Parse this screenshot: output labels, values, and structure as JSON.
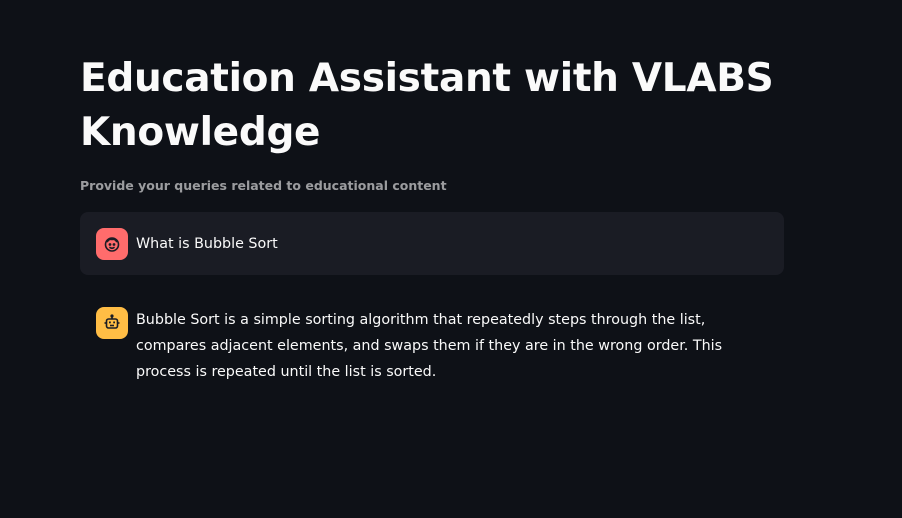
{
  "header": {
    "title": "Education Assistant with VLABS Knowledge",
    "caption": "Provide your queries related to educational content"
  },
  "messages": [
    {
      "role": "user",
      "avatar_icon": "user-face-icon",
      "avatar_color": "#ff6c6c",
      "text": "What is Bubble Sort"
    },
    {
      "role": "assistant",
      "avatar_icon": "robot-icon",
      "avatar_color": "#ffbd45",
      "text": "Bubble Sort is a simple sorting algorithm that repeatedly steps through the list, compares adjacent elements, and swaps them if they are in the wrong order. This process is repeated until the list is sorted."
    }
  ],
  "theme": {
    "background": "#0e1117",
    "user_bubble": "#1a1c24",
    "text": "#fafafa"
  }
}
